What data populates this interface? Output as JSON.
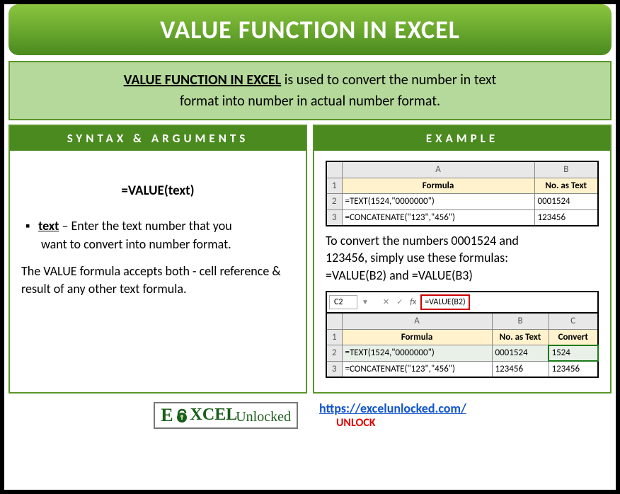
{
  "title": "VALUE FUNCTION IN EXCEL",
  "intro": {
    "bold": "VALUE FUNCTION IN EXCEL",
    "rest1": " is used to convert the number in text",
    "rest2": "format into number in actual number format."
  },
  "left": {
    "header": "SYNTAX & ARGUMENTS",
    "formula": "=VALUE(text)",
    "arg_name": "text",
    "arg_desc1": " – Enter the text number that you",
    "arg_desc2": "want to convert into number format.",
    "note": "The VALUE formula accepts both - cell reference & result of any other text formula."
  },
  "right": {
    "header": "EXAMPLE",
    "table1": {
      "colA": "A",
      "colB": "B",
      "h_formula": "Formula",
      "h_text": "No. as Text",
      "r1": "1",
      "r2": "2",
      "r3": "3",
      "c2a": "=TEXT(1524,\"0000000\")",
      "c2b": "0001524",
      "c3a": "=CONCATENATE(\"123\",\"456\")",
      "c3b": "123456"
    },
    "explain1": "To convert the numbers 0001524 and",
    "explain2": "123456, simply use these formulas:",
    "explain3": "=VALUE(B2) and =VALUE(B3)",
    "fx": {
      "cell": "C2",
      "formula": "=VALUE(B2)",
      "fx_label": "fx"
    },
    "table2": {
      "colA": "A",
      "colB": "B",
      "colC": "C",
      "h_formula": "Formula",
      "h_text": "No. as Text",
      "h_conv": "Convert",
      "r1": "1",
      "r2": "2",
      "r3": "3",
      "c2a": "=TEXT(1524,\"0000000\")",
      "c2b": "0001524",
      "c2c": "1524",
      "c3a": "=CONCATENATE(\"123\",\"456\")",
      "c3b": "123456",
      "c3c": "123456"
    }
  },
  "footer": {
    "logo_text_1": "E",
    "logo_text_2": "XCEL",
    "logo_sub": "Unlocked",
    "url": "https://excelunlocked.com/",
    "unlock": "UNLOCK"
  }
}
